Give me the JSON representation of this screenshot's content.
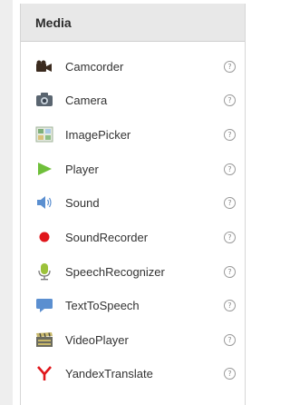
{
  "palette": {
    "title": "Media",
    "items": [
      {
        "label": "Camcorder",
        "icon": "camcorder-icon",
        "help": "?"
      },
      {
        "label": "Camera",
        "icon": "camera-icon",
        "help": "?"
      },
      {
        "label": "ImagePicker",
        "icon": "image-picker-icon",
        "help": "?"
      },
      {
        "label": "Player",
        "icon": "player-icon",
        "help": "?"
      },
      {
        "label": "Sound",
        "icon": "sound-icon",
        "help": "?"
      },
      {
        "label": "SoundRecorder",
        "icon": "sound-recorder-icon",
        "help": "?"
      },
      {
        "label": "SpeechRecognizer",
        "icon": "speech-recognizer-icon",
        "help": "?"
      },
      {
        "label": "TextToSpeech",
        "icon": "text-to-speech-icon",
        "help": "?"
      },
      {
        "label": "VideoPlayer",
        "icon": "video-player-icon",
        "help": "?"
      },
      {
        "label": "YandexTranslate",
        "icon": "yandex-translate-icon",
        "help": "?"
      }
    ]
  }
}
